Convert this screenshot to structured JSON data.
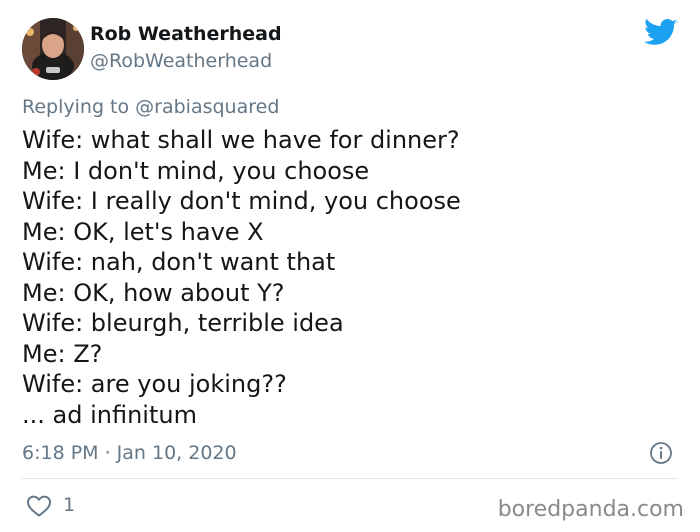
{
  "author": {
    "display_name": "Rob Weatherhead",
    "handle": "@RobWeatherhead"
  },
  "reply": {
    "prefix": "Replying to ",
    "mention": "@rabiasquared"
  },
  "tweet_lines": [
    "Wife: what shall we have for dinner?",
    "Me: I don't mind, you choose",
    "Wife: I really don't mind, you choose",
    "Me: OK, let's have X",
    "Wife: nah, don't want that",
    "Me: OK, how about Y?",
    "Wife: bleurgh, terrible idea",
    "Me: Z?",
    "Wife: are you joking??",
    "... ad infinitum"
  ],
  "timestamp": "6:18 PM · Jan 10, 2020",
  "likes": "1",
  "watermark": "boredpanda.com",
  "icons": {
    "brand": "twitter-bird-icon",
    "info": "info-icon",
    "like": "heart-icon"
  },
  "colors": {
    "brand_blue": "#1da1f2",
    "secondary_text": "#657786",
    "primary_text": "#14171a",
    "divider": "#e1e8ed",
    "watermark": "#8a8a8a"
  }
}
